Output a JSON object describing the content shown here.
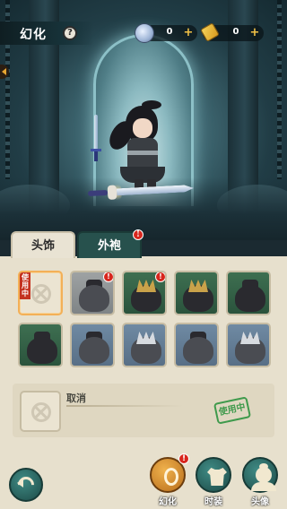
{
  "header": {
    "title": "幻化",
    "help_label": "?",
    "currencies": [
      {
        "icon": "jade-coin-icon",
        "value": "0",
        "add_label": "+"
      },
      {
        "icon": "scroll-icon",
        "value": "0",
        "add_label": "+"
      }
    ]
  },
  "tabs": [
    {
      "label": "头饰",
      "active": true
    },
    {
      "label": "外袍",
      "active": false,
      "badge": "!"
    }
  ],
  "grid": {
    "badge": "!",
    "in_use_tag": "使用中",
    "items": [
      {
        "kind": "none",
        "in_use": true
      },
      {
        "kind": "gray-hood",
        "badge": true
      },
      {
        "kind": "gold-crown",
        "badge": true
      },
      {
        "kind": "gold-crown-2"
      },
      {
        "kind": "dark-topknot"
      },
      {
        "kind": "dark-topknot-2"
      },
      {
        "kind": "blue-bun"
      },
      {
        "kind": "silver-crown"
      },
      {
        "kind": "dark-bun"
      },
      {
        "kind": "silver-crown-2"
      }
    ]
  },
  "preview": {
    "name": "取消",
    "status_stamp": "使用中"
  },
  "bottom_nav": [
    {
      "label": "幻化",
      "badge": "!",
      "icon": "transform-icon"
    },
    {
      "label": "时装",
      "icon": "outfit-icon"
    },
    {
      "label": "头像",
      "icon": "avatar-icon"
    }
  ],
  "colors": {
    "accent": "#27514d",
    "panel": "#e7e0cd",
    "badge": "#d8261d",
    "in_use_green": "#3f9a4c"
  }
}
